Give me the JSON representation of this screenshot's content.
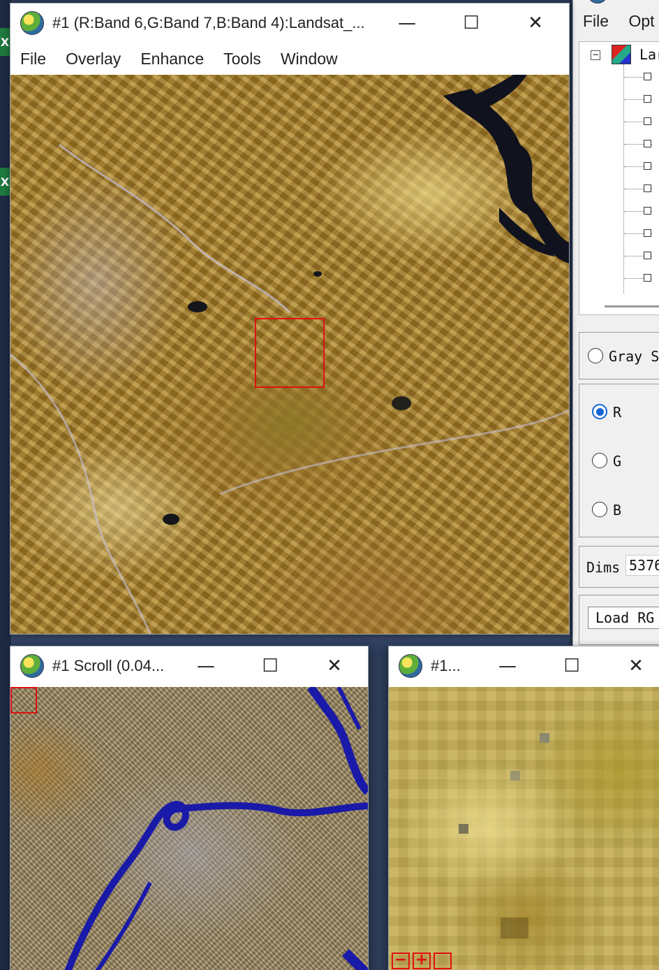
{
  "image_window": {
    "title": "#1 (R:Band 6,G:Band 7,B:Band 4):Landsat_...",
    "menu": [
      "File",
      "Overlay",
      "Enhance",
      "Tools",
      "Window"
    ]
  },
  "scroll_window": {
    "title": "#1 Scroll (0.04..."
  },
  "zoom_window": {
    "title": "#1..."
  },
  "band_list_window": {
    "menu": [
      "File",
      "Opt"
    ],
    "tree_root_label": "Lar",
    "gray_scale_label": "Gray S",
    "rgb_options": [
      "R",
      "G",
      "B"
    ],
    "selected_channel": "R",
    "dims_label": "Dims",
    "dims_value": "5376",
    "load_button_label": "Load RG"
  },
  "window_controls": {
    "minimize": "—",
    "maximize": "☐",
    "close": "✕"
  },
  "colors": {
    "roi_box": "#e01010",
    "river": "#1a1aa8",
    "selected_radio": "#1464d6"
  }
}
